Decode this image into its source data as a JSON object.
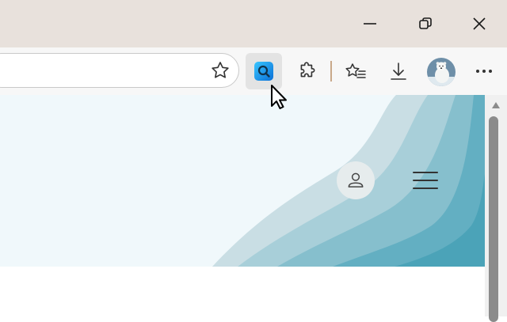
{
  "window_controls": {
    "minimize_icon": "minimize-icon",
    "restore_icon": "restore-icon",
    "close_icon": "close-icon"
  },
  "toolbar": {
    "favorite_icon": "star-icon",
    "buttons": [
      {
        "icon": "visual-search-icon",
        "active": true
      },
      {
        "icon": "extensions-icon"
      },
      {
        "icon": "favorites-icon"
      },
      {
        "icon": "download-icon"
      },
      {
        "icon": "profile-avatar"
      },
      {
        "icon": "more-icon"
      }
    ]
  },
  "page": {
    "account_icon": "account-icon",
    "menu_icon": "hamburger-menu-icon"
  },
  "colors": {
    "titlebar": "#e8e1dc",
    "toolbar": "#f7f7f7",
    "active_button": "#e3e3e3",
    "visual_search_accent": "#1a9de8",
    "banner_light": "#f0f8fb",
    "banner_teal": "#4ba3b8"
  }
}
